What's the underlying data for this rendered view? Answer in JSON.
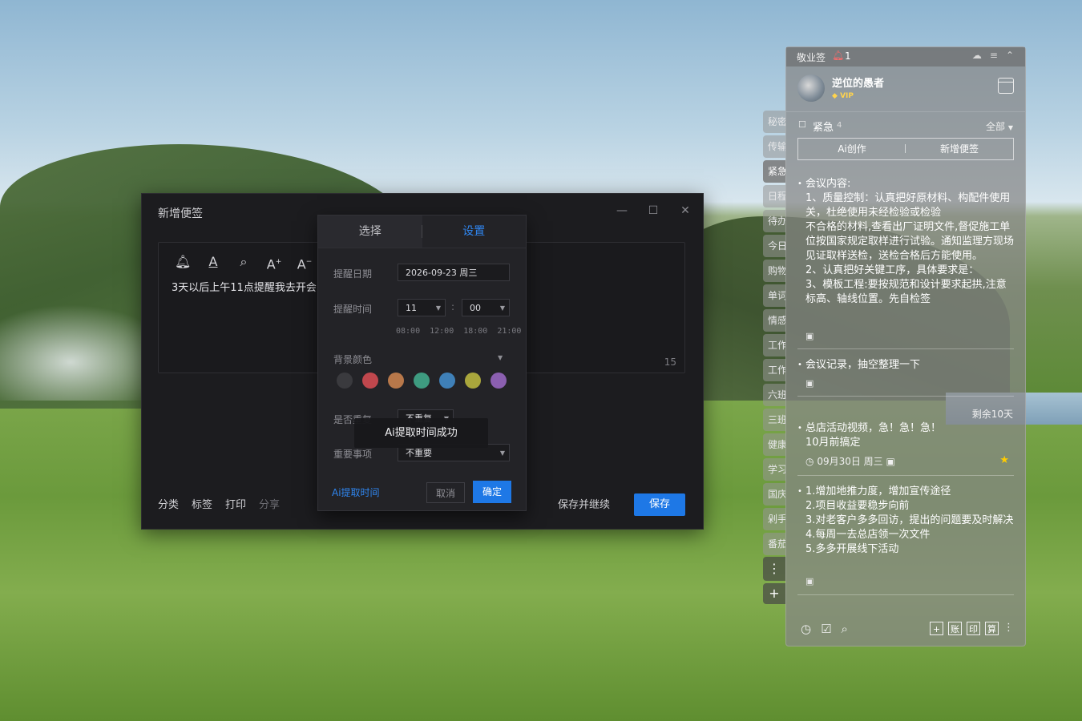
{
  "dialog": {
    "title": "新增便签",
    "minimize": "—",
    "maximize": "☐",
    "close": "✕",
    "editor_text": "3天以后上午11点提醒我去开会",
    "char_count": "15",
    "footer_left": [
      "分类",
      "标签",
      "打印",
      "分享"
    ],
    "save_continue": "保存并继续",
    "save": "保存"
  },
  "toolbar_icons": [
    "bell-icon",
    "text-color-icon",
    "search-icon",
    "font-increase-icon",
    "font-decrease-icon"
  ],
  "popup": {
    "tab_select": "选择",
    "tab_settings": "设置",
    "reminder_date_label": "提醒日期",
    "reminder_date_value": "2026-09-23  周三",
    "reminder_time_label": "提醒时间",
    "hour": "11",
    "minute": "00",
    "time_sep": ":",
    "quick_times": [
      "08:00",
      "12:00",
      "18:00",
      "21:00"
    ],
    "bg_color_label": "背景颜色",
    "colors": [
      "#3a3a3e",
      "#c0474d",
      "#b8784a",
      "#3e9b80",
      "#3f80b8",
      "#a9a63c",
      "#8b5fb0"
    ],
    "repeat_label": "是否重复",
    "repeat_value": "不重复",
    "important_label": "重要事项",
    "important_value": "不重要",
    "ai_extract": "Ai提取时间",
    "cancel": "取消",
    "ok": "确定",
    "toast": "Ai提取时间成功"
  },
  "side_tabs": {
    "items": [
      "秘密",
      "传输",
      "紧急",
      "日程",
      "待办",
      "今日",
      "购物",
      "单词",
      "情感",
      "工作",
      "工作",
      "六班",
      "三班",
      "健康",
      "学习",
      "国庆",
      "剁手",
      "番茄"
    ],
    "active_index": 2,
    "more": "⋮",
    "add": "+"
  },
  "panel": {
    "app_name": "敬业签",
    "bell_count": "1",
    "username": "逆位的愚者",
    "vip": "VIP",
    "category": "紧急",
    "category_count": "4",
    "filter": "全部",
    "ai_create": "Ai创作",
    "new_note": "新增便签",
    "notes": [
      "会议内容:\n1、质量控制：认真把好原材料、构配件使用关，杜绝使用未经检验或检验\n不合格的材料,查看出厂证明文件,督促施工单位按国家规定取样进行试验。通知监理方现场见证取样送检，送检合格后方能使用。\n2、认真把好关键工序，具体要求是：\n3、模板工程:要按规范和设计要求起拱,注意标高、轴线位置。先自检签",
      "会议记录，抽空整理一下",
      "总店活动视频，急！急！急！\n10月前搞定",
      "1.增加地推力度，增加宣传途径\n2.项目收益要稳步向前\n3.对老客户多多回访，提出的问题要及时解决\n4.每周一去总店领一次文件\n5.多多开展线下活动"
    ],
    "remaining": "剩余10天",
    "note3_meta": "09月30日 周三",
    "footer_right": [
      "+",
      "账",
      "印",
      "算"
    ]
  }
}
